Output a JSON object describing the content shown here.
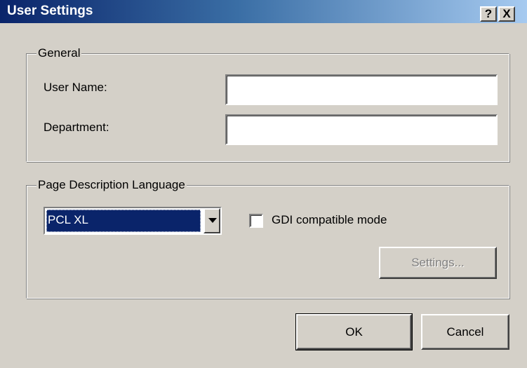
{
  "window": {
    "title": "User Settings",
    "help_glyph": "?",
    "close_glyph": "X"
  },
  "general": {
    "legend": "General",
    "user_name_label": "User Name:",
    "user_name_value": "",
    "department_label": "Department:",
    "department_value": ""
  },
  "pdl": {
    "legend": "Page Description Language",
    "selected": "PCL XL",
    "gdi_label": "GDI compatible mode",
    "gdi_checked": false,
    "settings_label": "Settings..."
  },
  "footer": {
    "ok_label": "OK",
    "cancel_label": "Cancel"
  },
  "colors": {
    "titlebar_start": "#0a246a",
    "titlebar_end": "#a6caf0",
    "face": "#d4d0c8",
    "selection": "#0a246a"
  }
}
